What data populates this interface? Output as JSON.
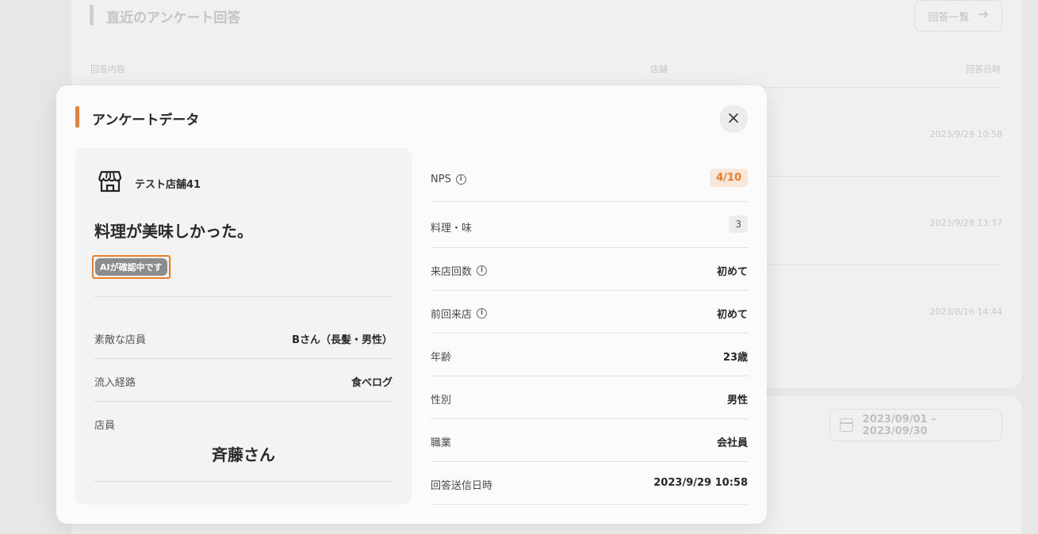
{
  "background": {
    "section_title": "直近のアンケート回答",
    "list_button_label": "回答一覧",
    "columns": [
      "回答内容",
      "店舗",
      "回答日時"
    ],
    "rows": [
      {
        "date": "2023/9/29 10:58"
      },
      {
        "date": "2023/9/28 13:37"
      },
      {
        "date": "2023/8/16 14:44"
      }
    ],
    "date_range": "2023/09/01 – 2023/09/30"
  },
  "modal": {
    "title": "アンケートデータ",
    "close_icon": "close-icon",
    "left": {
      "store_icon": "store-icon",
      "store_name": "テスト店舗41",
      "comment": "料理が美味しかった。",
      "ai_badge": "AIが確認中です",
      "fields": [
        {
          "label": "素敵な店員",
          "value": "Bさん（長髪・男性）"
        },
        {
          "label": "流入経路",
          "value": "食べログ"
        }
      ],
      "staff_label": "店員",
      "staff_name": "斉藤さん"
    },
    "right": {
      "nps_label": "NPS",
      "nps_value": "4/10",
      "taste_label": "料理・味",
      "taste_value": "3",
      "visits_label": "来店回数",
      "visits_value": "初めて",
      "last_visit_label": "前回来店",
      "last_visit_value": "初めて",
      "age_label": "年齢",
      "age_value": "23歳",
      "gender_label": "性別",
      "gender_value": "男性",
      "job_label": "職業",
      "job_value": "会社員",
      "sent_label": "回答送信日時",
      "sent_value": "2023/9/29 10:58"
    }
  },
  "colors": {
    "accent": "#f07f2d",
    "badge_bg": "#fbe7da",
    "ai_badge_bg": "#8c8c8c"
  }
}
